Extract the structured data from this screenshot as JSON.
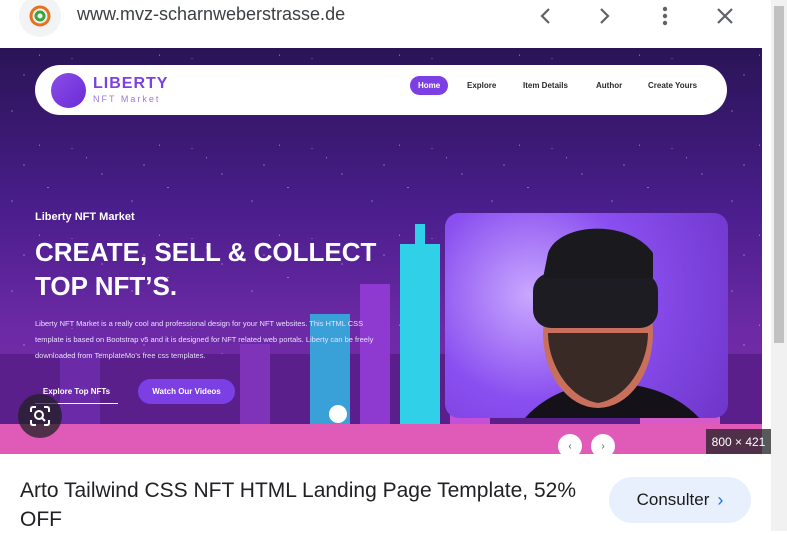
{
  "browser": {
    "url": "www.mvz-scharnweberstrasse.de",
    "icons": [
      "back-chevron-icon",
      "forward-chevron-icon",
      "more-vert-icon",
      "close-icon"
    ]
  },
  "preview": {
    "nav": {
      "logo_title": "LIBERTY",
      "logo_subtitle": "NFT Market",
      "items": [
        "Home",
        "Explore",
        "Item Details",
        "Author",
        "Create Yours"
      ]
    },
    "hero": {
      "kicker": "Liberty NFT Market",
      "title": "CREATE, SELL & COLLECT TOP NFT’S.",
      "text": "Liberty NFT Market is a really cool and professional design for your NFT websites. This HTML CSS template is based on Bootstrap v5 and it is designed for NFT related web portals. Liberty can be freely downloaded from TemplateMo's free css templates.",
      "button_primary": "Explore Top NFTs",
      "button_secondary": "Watch Our Videos"
    },
    "carousel": {
      "prev": "‹",
      "next": "›"
    },
    "dimensions": "800 × 421"
  },
  "result": {
    "caption": "Arto Tailwind CSS NFT HTML Landing Page Template, 52% OFF",
    "action_label": "Consulter",
    "action_chevron": "›"
  },
  "colors": {
    "accent": "#7b3fe4",
    "link": "#1a73e8"
  }
}
